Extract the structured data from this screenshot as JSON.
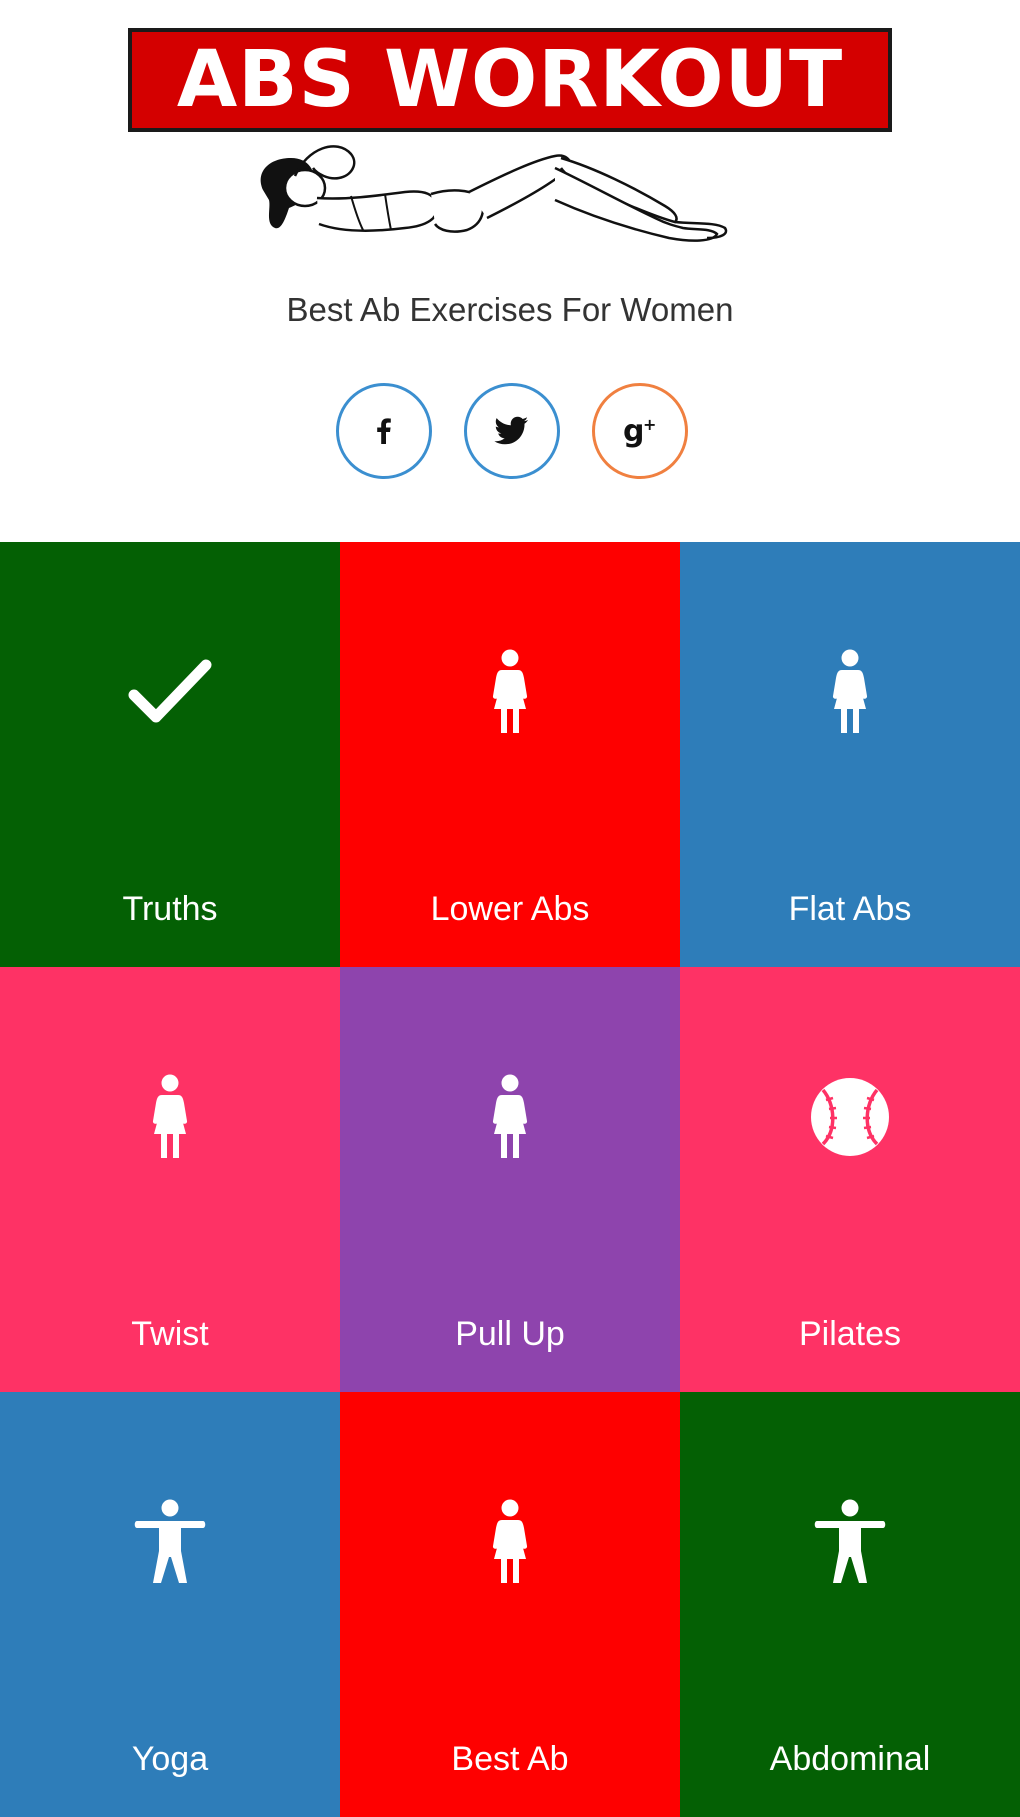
{
  "header": {
    "logo_text": "ABS WORKOUT",
    "tagline": "Best Ab Exercises For Women",
    "social": [
      {
        "icon": "facebook-icon",
        "glyph": "f",
        "color": "#3b8fd0"
      },
      {
        "icon": "twitter-icon",
        "color": "#3b8fd0"
      },
      {
        "icon": "google-plus-icon",
        "glyph": "g+",
        "color": "#f08040"
      }
    ]
  },
  "colors": {
    "logo_red": "#d40000",
    "green": "#046004",
    "red": "#fe0000",
    "blue": "#2e7db9",
    "pink": "#fe3265",
    "purple": "#8e44ad"
  },
  "tiles": [
    {
      "label": "Truths",
      "icon": "checkmark-icon",
      "color": "#046004"
    },
    {
      "label": "Lower Abs",
      "icon": "woman-icon",
      "color": "#fe0000"
    },
    {
      "label": "Flat Abs",
      "icon": "woman-icon",
      "color": "#2e7db9"
    },
    {
      "label": "Twist",
      "icon": "woman-icon",
      "color": "#fe3265"
    },
    {
      "label": "Pull Up",
      "icon": "woman-icon",
      "color": "#8e44ad"
    },
    {
      "label": "Pilates",
      "icon": "baseball-icon",
      "color": "#fe3265"
    },
    {
      "label": "Yoga",
      "icon": "person-arms-out-icon",
      "color": "#2e7db9"
    },
    {
      "label": "Best Ab",
      "icon": "woman-icon",
      "color": "#fe0000"
    },
    {
      "label": "Abdominal",
      "icon": "person-arms-out-icon",
      "color": "#046004"
    }
  ]
}
